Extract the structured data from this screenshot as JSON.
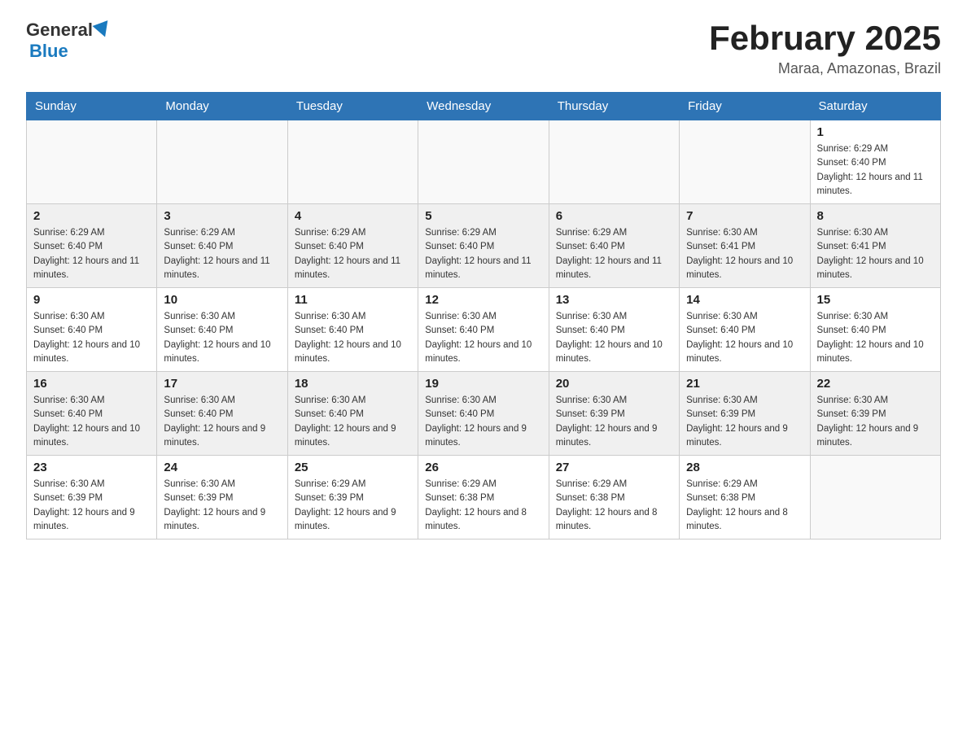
{
  "header": {
    "logo_general": "General",
    "logo_blue": "Blue",
    "title": "February 2025",
    "subtitle": "Maraa, Amazonas, Brazil"
  },
  "days_of_week": [
    "Sunday",
    "Monday",
    "Tuesday",
    "Wednesday",
    "Thursday",
    "Friday",
    "Saturday"
  ],
  "weeks": [
    [
      {
        "day": "",
        "sunrise": "",
        "sunset": "",
        "daylight": ""
      },
      {
        "day": "",
        "sunrise": "",
        "sunset": "",
        "daylight": ""
      },
      {
        "day": "",
        "sunrise": "",
        "sunset": "",
        "daylight": ""
      },
      {
        "day": "",
        "sunrise": "",
        "sunset": "",
        "daylight": ""
      },
      {
        "day": "",
        "sunrise": "",
        "sunset": "",
        "daylight": ""
      },
      {
        "day": "",
        "sunrise": "",
        "sunset": "",
        "daylight": ""
      },
      {
        "day": "1",
        "sunrise": "Sunrise: 6:29 AM",
        "sunset": "Sunset: 6:40 PM",
        "daylight": "Daylight: 12 hours and 11 minutes."
      }
    ],
    [
      {
        "day": "2",
        "sunrise": "Sunrise: 6:29 AM",
        "sunset": "Sunset: 6:40 PM",
        "daylight": "Daylight: 12 hours and 11 minutes."
      },
      {
        "day": "3",
        "sunrise": "Sunrise: 6:29 AM",
        "sunset": "Sunset: 6:40 PM",
        "daylight": "Daylight: 12 hours and 11 minutes."
      },
      {
        "day": "4",
        "sunrise": "Sunrise: 6:29 AM",
        "sunset": "Sunset: 6:40 PM",
        "daylight": "Daylight: 12 hours and 11 minutes."
      },
      {
        "day": "5",
        "sunrise": "Sunrise: 6:29 AM",
        "sunset": "Sunset: 6:40 PM",
        "daylight": "Daylight: 12 hours and 11 minutes."
      },
      {
        "day": "6",
        "sunrise": "Sunrise: 6:29 AM",
        "sunset": "Sunset: 6:40 PM",
        "daylight": "Daylight: 12 hours and 11 minutes."
      },
      {
        "day": "7",
        "sunrise": "Sunrise: 6:30 AM",
        "sunset": "Sunset: 6:41 PM",
        "daylight": "Daylight: 12 hours and 10 minutes."
      },
      {
        "day": "8",
        "sunrise": "Sunrise: 6:30 AM",
        "sunset": "Sunset: 6:41 PM",
        "daylight": "Daylight: 12 hours and 10 minutes."
      }
    ],
    [
      {
        "day": "9",
        "sunrise": "Sunrise: 6:30 AM",
        "sunset": "Sunset: 6:40 PM",
        "daylight": "Daylight: 12 hours and 10 minutes."
      },
      {
        "day": "10",
        "sunrise": "Sunrise: 6:30 AM",
        "sunset": "Sunset: 6:40 PM",
        "daylight": "Daylight: 12 hours and 10 minutes."
      },
      {
        "day": "11",
        "sunrise": "Sunrise: 6:30 AM",
        "sunset": "Sunset: 6:40 PM",
        "daylight": "Daylight: 12 hours and 10 minutes."
      },
      {
        "day": "12",
        "sunrise": "Sunrise: 6:30 AM",
        "sunset": "Sunset: 6:40 PM",
        "daylight": "Daylight: 12 hours and 10 minutes."
      },
      {
        "day": "13",
        "sunrise": "Sunrise: 6:30 AM",
        "sunset": "Sunset: 6:40 PM",
        "daylight": "Daylight: 12 hours and 10 minutes."
      },
      {
        "day": "14",
        "sunrise": "Sunrise: 6:30 AM",
        "sunset": "Sunset: 6:40 PM",
        "daylight": "Daylight: 12 hours and 10 minutes."
      },
      {
        "day": "15",
        "sunrise": "Sunrise: 6:30 AM",
        "sunset": "Sunset: 6:40 PM",
        "daylight": "Daylight: 12 hours and 10 minutes."
      }
    ],
    [
      {
        "day": "16",
        "sunrise": "Sunrise: 6:30 AM",
        "sunset": "Sunset: 6:40 PM",
        "daylight": "Daylight: 12 hours and 10 minutes."
      },
      {
        "day": "17",
        "sunrise": "Sunrise: 6:30 AM",
        "sunset": "Sunset: 6:40 PM",
        "daylight": "Daylight: 12 hours and 9 minutes."
      },
      {
        "day": "18",
        "sunrise": "Sunrise: 6:30 AM",
        "sunset": "Sunset: 6:40 PM",
        "daylight": "Daylight: 12 hours and 9 minutes."
      },
      {
        "day": "19",
        "sunrise": "Sunrise: 6:30 AM",
        "sunset": "Sunset: 6:40 PM",
        "daylight": "Daylight: 12 hours and 9 minutes."
      },
      {
        "day": "20",
        "sunrise": "Sunrise: 6:30 AM",
        "sunset": "Sunset: 6:39 PM",
        "daylight": "Daylight: 12 hours and 9 minutes."
      },
      {
        "day": "21",
        "sunrise": "Sunrise: 6:30 AM",
        "sunset": "Sunset: 6:39 PM",
        "daylight": "Daylight: 12 hours and 9 minutes."
      },
      {
        "day": "22",
        "sunrise": "Sunrise: 6:30 AM",
        "sunset": "Sunset: 6:39 PM",
        "daylight": "Daylight: 12 hours and 9 minutes."
      }
    ],
    [
      {
        "day": "23",
        "sunrise": "Sunrise: 6:30 AM",
        "sunset": "Sunset: 6:39 PM",
        "daylight": "Daylight: 12 hours and 9 minutes."
      },
      {
        "day": "24",
        "sunrise": "Sunrise: 6:30 AM",
        "sunset": "Sunset: 6:39 PM",
        "daylight": "Daylight: 12 hours and 9 minutes."
      },
      {
        "day": "25",
        "sunrise": "Sunrise: 6:29 AM",
        "sunset": "Sunset: 6:39 PM",
        "daylight": "Daylight: 12 hours and 9 minutes."
      },
      {
        "day": "26",
        "sunrise": "Sunrise: 6:29 AM",
        "sunset": "Sunset: 6:38 PM",
        "daylight": "Daylight: 12 hours and 8 minutes."
      },
      {
        "day": "27",
        "sunrise": "Sunrise: 6:29 AM",
        "sunset": "Sunset: 6:38 PM",
        "daylight": "Daylight: 12 hours and 8 minutes."
      },
      {
        "day": "28",
        "sunrise": "Sunrise: 6:29 AM",
        "sunset": "Sunset: 6:38 PM",
        "daylight": "Daylight: 12 hours and 8 minutes."
      },
      {
        "day": "",
        "sunrise": "",
        "sunset": "",
        "daylight": ""
      }
    ]
  ]
}
